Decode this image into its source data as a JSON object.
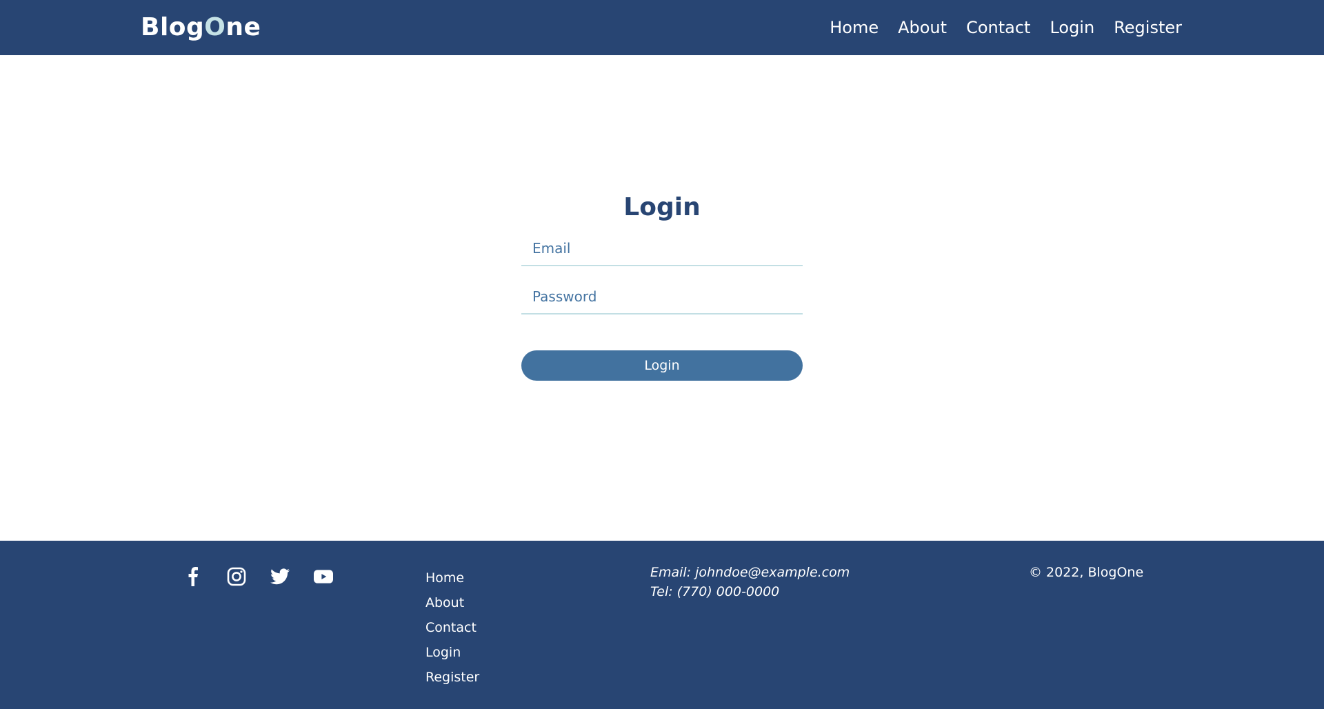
{
  "header": {
    "brand_prefix": "Blog",
    "brand_accent": "O",
    "brand_suffix": "ne",
    "nav": [
      "Home",
      "About",
      "Contact",
      "Login",
      "Register"
    ]
  },
  "login": {
    "title": "Login",
    "email_placeholder": "Email",
    "email_value": "",
    "password_placeholder": "Password",
    "password_value": "",
    "submit_label": "Login"
  },
  "footer": {
    "social_icons": [
      "facebook-icon",
      "instagram-icon",
      "twitter-icon",
      "youtube-icon"
    ],
    "links": [
      "Home",
      "About",
      "Contact",
      "Login",
      "Register"
    ],
    "email": "Email: johndoe@example.com",
    "tel": "Tel: (770) 000-0000",
    "copyright": "© 2022, BlogOne"
  },
  "colors": {
    "primary": "#284573",
    "accent": "#c5e2e6",
    "button": "#42729f"
  }
}
